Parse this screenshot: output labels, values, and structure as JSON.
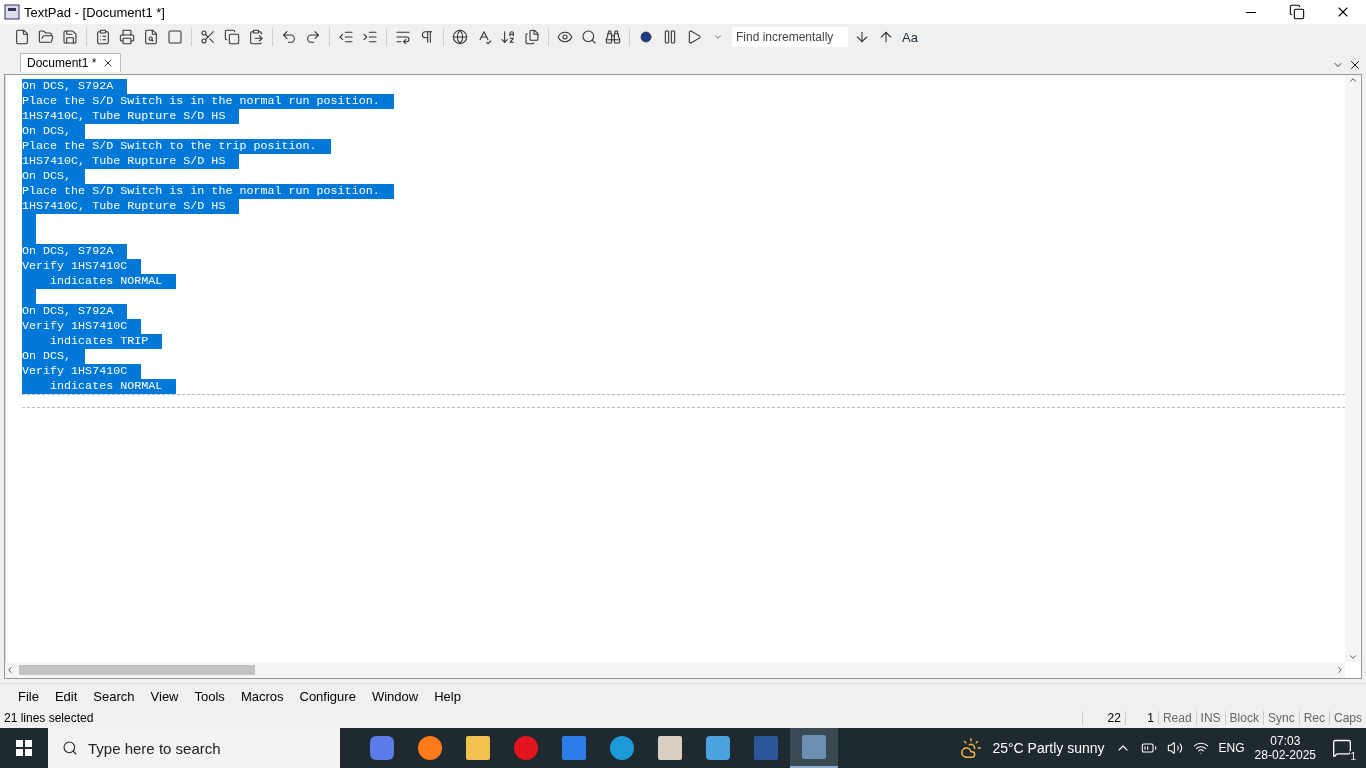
{
  "window": {
    "title": "TextPad - [Document1 *]"
  },
  "toolbar": {
    "find_placeholder": "Find incrementally",
    "case_button": "Aa"
  },
  "tabs": [
    {
      "label": "Document1 *",
      "selected": true
    }
  ],
  "editor": {
    "lines": [
      {
        "text": "On DCS, S792A",
        "selected": true
      },
      {
        "text": "Place the S/D Switch is in the normal run position.",
        "selected": true
      },
      {
        "text": "1HS7410C, Tube Rupture S/D HS",
        "selected": true
      },
      {
        "text": "On DCS,",
        "selected": true
      },
      {
        "text": "Place the S/D Switch to the trip position.",
        "selected": true
      },
      {
        "text": "1HS7410C, Tube Rupture S/D HS",
        "selected": true
      },
      {
        "text": "On DCS,",
        "selected": true
      },
      {
        "text": "Place the S/D Switch is in the normal run position.",
        "selected": true
      },
      {
        "text": "1HS7410C, Tube Rupture S/D HS",
        "selected": true
      },
      {
        "selected": true
      },
      {
        "selected": true
      },
      {
        "text": "On DCS, S792A",
        "selected": true
      },
      {
        "text": "Verify 1HS7410C",
        "selected": true
      },
      {
        "text": "    indicates NORMAL",
        "selected": true
      },
      {
        "selected": true
      },
      {
        "text": "On DCS, S792A",
        "selected": true
      },
      {
        "text": "Verify 1HS7410C",
        "selected": true
      },
      {
        "text": "    indicates TRIP",
        "selected": true
      },
      {
        "text": "On DCS,",
        "selected": true
      },
      {
        "text": "Verify 1HS7410C",
        "selected": true
      },
      {
        "text": "    indicates NORMAL",
        "selected": true
      }
    ]
  },
  "menu": [
    "File",
    "Edit",
    "Search",
    "View",
    "Tools",
    "Macros",
    "Configure",
    "Window",
    "Help"
  ],
  "status_bar": {
    "message": "21 lines selected",
    "line": "22",
    "column": "1",
    "indicators": [
      "Read",
      "INS",
      "Block",
      "Sync",
      "Rec",
      "Caps"
    ]
  },
  "taskbar": {
    "search_placeholder": "Type here to search",
    "weather": "25°C  Partly sunny",
    "language": "ENG",
    "time": "07:03",
    "date": "28-02-2025",
    "notifications": "1"
  }
}
